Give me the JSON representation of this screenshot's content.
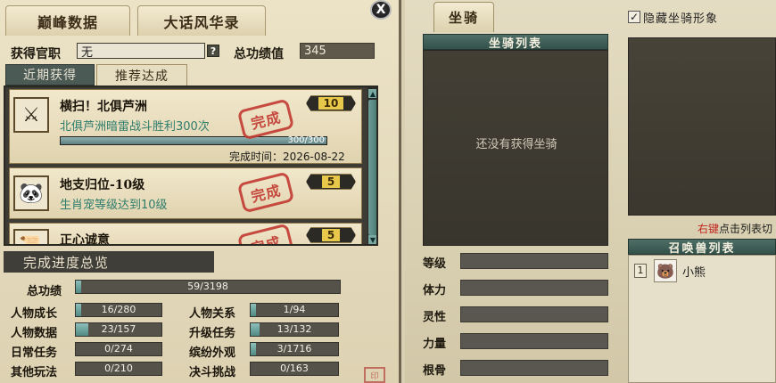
{
  "left": {
    "tabs": [
      "巅峰数据",
      "大话风华录"
    ],
    "close_label": "X",
    "title_label": "获得官职",
    "title_value": "无",
    "help_label": "?",
    "points_label": "总功绩值",
    "points_value": "345",
    "sub_tabs": [
      "近期获得",
      "推荐达成"
    ],
    "achievements": [
      {
        "title": "横扫！北俱芦洲",
        "desc": "北俱芦洲暗雷战斗胜利300次",
        "points": "10",
        "stamp": "完成",
        "icon": "warrior-icon",
        "progress_text": "300/300",
        "progress": 1.0,
        "time_label": "完成时间：2026-08-22"
      },
      {
        "title": "地支归位-10级",
        "desc": "生肖宠等级达到10级",
        "points": "5",
        "stamp": "完成",
        "icon": "panda-icon"
      },
      {
        "title": "正心诚意",
        "points": "5",
        "stamp": "完成",
        "icon": "scroll-icon"
      }
    ],
    "overview_title": "完成进度总览",
    "total": {
      "label": "总功绩",
      "value": "59/3198",
      "ratio": 0.018
    },
    "stats": [
      {
        "label": "人物成长",
        "value": "16/280",
        "ratio": 0.057
      },
      {
        "label": "人物关系",
        "value": "1/94",
        "ratio": 0.011
      },
      {
        "label": "人物数据",
        "value": "23/157",
        "ratio": 0.146
      },
      {
        "label": "升级任务",
        "value": "13/132",
        "ratio": 0.098
      },
      {
        "label": "日常任务",
        "value": "0/274",
        "ratio": 0
      },
      {
        "label": "缤纷外观",
        "value": "3/1716",
        "ratio": 0.002
      },
      {
        "label": "其他玩法",
        "value": "0/210",
        "ratio": 0
      },
      {
        "label": "决斗挑战",
        "value": "0/163",
        "ratio": 0
      }
    ],
    "seal_text": "印"
  },
  "right": {
    "tab": "坐骑",
    "hide_checkbox_mark": "✓",
    "hide_label": "隐藏坐骑形象",
    "mount_list_title": "坐骑列表",
    "empty_text": "还没有获得坐骑",
    "hint_red": "右键",
    "hint_rest": "点击列表切",
    "summon_list_title": "召唤兽列表",
    "summon": {
      "index": "1",
      "name": "小熊",
      "icon": "bear-icon"
    },
    "attributes": [
      "等级",
      "体力",
      "灵性",
      "力量",
      "根骨"
    ]
  },
  "colors": {
    "accent_teal": "#4f8a83",
    "stamp_red": "#c23a32",
    "desc_green": "#2e7d6c",
    "hint_red": "#c1261d"
  }
}
